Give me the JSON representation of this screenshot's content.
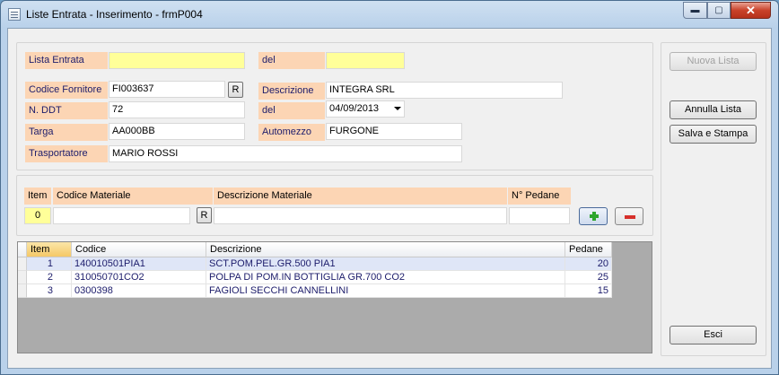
{
  "window": {
    "title": "Liste Entrata - Inserimento - frmP004",
    "min_glyph": "▬",
    "max_glyph": "▢",
    "close_glyph": "✕"
  },
  "header_form": {
    "lista_entrata": {
      "label": "Lista Entrata",
      "value": ""
    },
    "del_lista": {
      "label": "del",
      "value": ""
    },
    "codice_fornitore": {
      "label": "Codice Fornitore",
      "value": "FI003637",
      "lookup": "R"
    },
    "descrizione": {
      "label": "Descrizione",
      "value": "INTEGRA SRL"
    },
    "n_ddt": {
      "label": "N. DDT",
      "value": "72"
    },
    "del_ddt": {
      "label": "del",
      "value": "04/09/2013"
    },
    "targa": {
      "label": "Targa",
      "value": "AA000BB"
    },
    "automezzo": {
      "label": "Automezzo",
      "value": "FURGONE"
    },
    "trasportatore": {
      "label": "Trasportatore",
      "value": "MARIO ROSSI"
    }
  },
  "item_entry": {
    "headers": {
      "item": "Item",
      "codice": "Codice Materiale",
      "descrizione": "Descrizione Materiale",
      "pedane": "N° Pedane"
    },
    "item_value": "0",
    "codice_value": "",
    "descrizione_value": "",
    "pedane_value": "",
    "lookup": "R"
  },
  "grid": {
    "columns": [
      "Item",
      "Codice",
      "Descrizione",
      "Pedane"
    ],
    "rows": [
      {
        "item": "1",
        "codice": "140010501PIA1",
        "descrizione": "SCT.POM.PEL.GR.500 PIA1",
        "pedane": "20"
      },
      {
        "item": "2",
        "codice": "310050701CO2",
        "descrizione": "POLPA DI POM.IN BOTTIGLIA GR.700 CO2",
        "pedane": "25"
      },
      {
        "item": "3",
        "codice": "0300398",
        "descrizione": "FAGIOLI SECCHI CANNELLINI",
        "pedane": "15"
      }
    ]
  },
  "buttons": {
    "nuova_lista": "Nuova Lista",
    "annulla_lista": "Annulla Lista",
    "salva_stampa": "Salva e Stampa",
    "esci": "Esci"
  },
  "colors": {
    "label_bg": "#fcd5b4",
    "required_bg": "#ffff99",
    "selected_row": "#dfe6f7"
  }
}
